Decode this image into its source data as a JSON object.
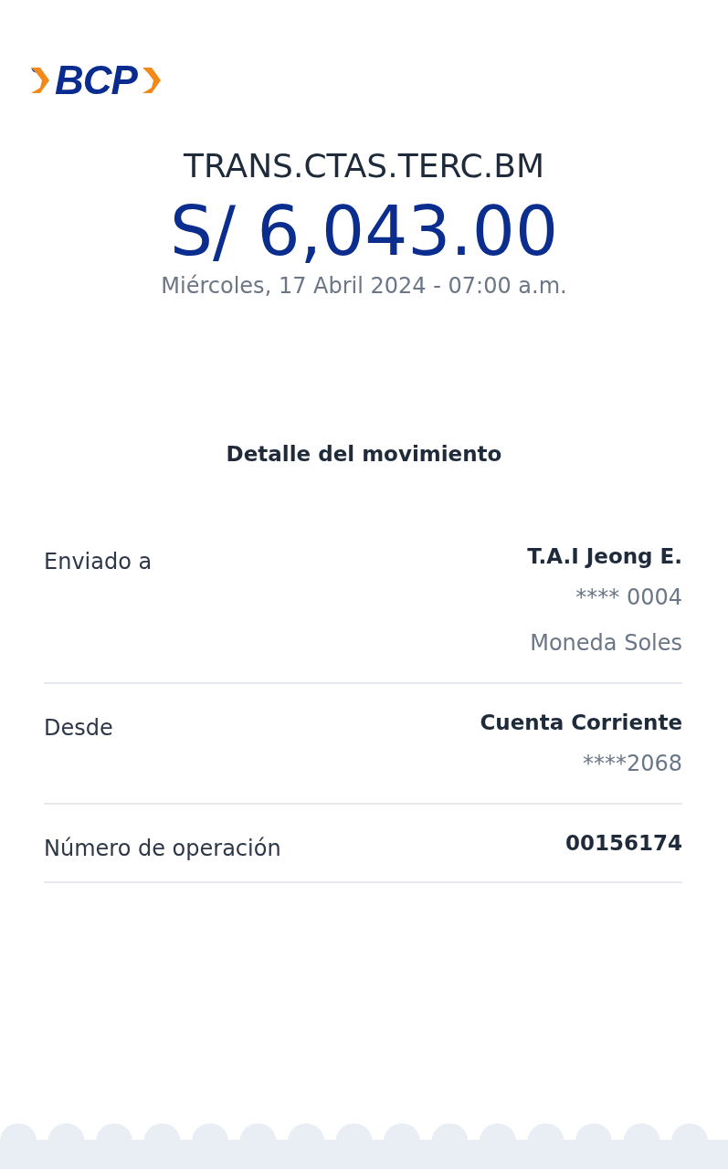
{
  "logo": {
    "text": "BCP"
  },
  "title": "TRANS.CTAS.TERC.BM",
  "amount": "S/ 6,043.00",
  "datetime": "Miércoles, 17 Abril 2024 - 07:00 a.m.",
  "section_title": "Detalle del movimiento",
  "details": [
    {
      "label": "Enviado a",
      "values": [
        "T.A.I Jeong E.",
        "**** 0004",
        "Moneda Soles"
      ]
    },
    {
      "label": "Desde",
      "values": [
        "Cuenta Corriente",
        "****2068"
      ]
    },
    {
      "label": "Número de operación",
      "values": [
        "00156174"
      ]
    }
  ]
}
